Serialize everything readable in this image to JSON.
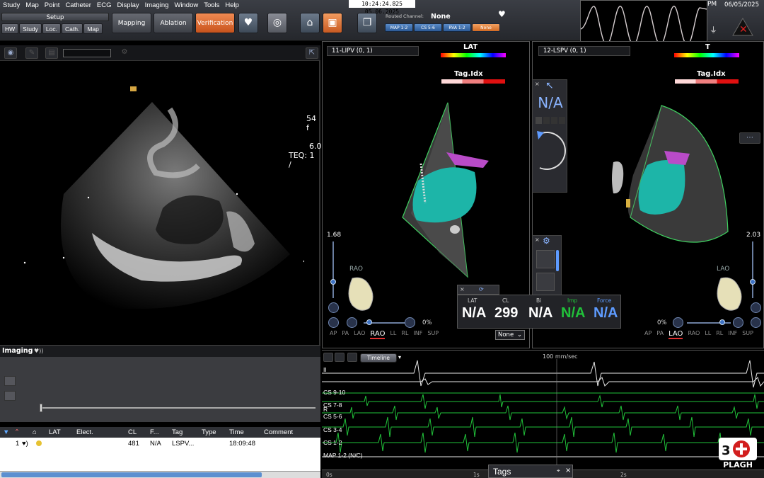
{
  "menu": [
    "Study",
    "Map",
    "Point",
    "Catheter",
    "ECG",
    "Display",
    "Imaging",
    "Window",
    "Tools",
    "Help"
  ],
  "clock": "10:24:24.825  05.06.2025",
  "setup": {
    "label": "Setup",
    "buttons": [
      "HW",
      "Study",
      "Loc.",
      "Cath.",
      "Map"
    ]
  },
  "modes": {
    "mapping": "Mapping",
    "ablation": "Ablation",
    "verification": "Verification"
  },
  "routed": {
    "label": "Routed Channel:",
    "value": "None",
    "channels": [
      "MAP 1-2",
      "CS 5-6",
      "RVA 1-2",
      "None"
    ]
  },
  "right_header": {
    "time_suffix": "PM",
    "date": "06/05/2025"
  },
  "icons": {
    "heart": "heart-icon",
    "gear": "gear-icon",
    "plug": "plug-icon",
    "alert": "alert-icon",
    "speaker": "speaker-icon",
    "chevron": "chevron-down-icon",
    "close": "close-icon"
  },
  "imaging": {
    "info_line1": "54 f",
    "info_line2": "6.0",
    "info_line3": "TEQ: 1 /",
    "label": "Imaging"
  },
  "points_table": {
    "headers": [
      "LAT",
      "Elect.",
      "CL",
      "F...",
      "Tag",
      "Type",
      "Time",
      "Comment"
    ],
    "row": {
      "index": "1",
      "cl": "481",
      "f": "N/A",
      "tag": "LSPV...",
      "time": "18:09:48"
    }
  },
  "map_left": {
    "selector": "11-LIPV (0, 1)",
    "lat_label": "LAT",
    "tag_label": "Tag.Idx",
    "scale": "1.68",
    "view": "RAO",
    "zoom": "0%",
    "orientations": [
      "AP",
      "PA",
      "LAO",
      "RAO",
      "LL",
      "RL",
      "INF",
      "SUP"
    ],
    "active_orientation": "RAO"
  },
  "map_right": {
    "selector": "12-LSPV (0, 1)",
    "lat_label": "T",
    "tag_label": "Tag.Idx",
    "scale": "2.03",
    "view": "LAO",
    "zoom": "0%",
    "orientations": [
      "AP",
      "PA",
      "LAO",
      "RAO",
      "LL",
      "RL",
      "INF",
      "SUP"
    ],
    "active_orientation": "LAO"
  },
  "float_widget": {
    "value": "N/A"
  },
  "readout": {
    "labels": [
      "LAT",
      "CL",
      "Bi",
      "Imp",
      "Force"
    ],
    "values": [
      "N/A",
      "299",
      "N/A",
      "N/A",
      "N/A"
    ],
    "select": "None"
  },
  "ecg": {
    "timeline": "Timeline",
    "speed": "100 mm/sec",
    "leads": [
      "II",
      "CS 9-10",
      "CS 7-8",
      "R",
      "CS 5-6",
      "CS 3-4",
      "CS 1-2",
      "MAP 1-2 (N/C)"
    ],
    "time_ticks": [
      "0s",
      "1s",
      "2s"
    ]
  },
  "tags_panel": {
    "label": "Tags"
  },
  "logo": {
    "text": "PLAGH"
  },
  "colors": {
    "orange": "#d9672c",
    "blue": "#3e72c4",
    "ecg_green": "#21c23a",
    "lesion_teal": "#19b8a6"
  }
}
